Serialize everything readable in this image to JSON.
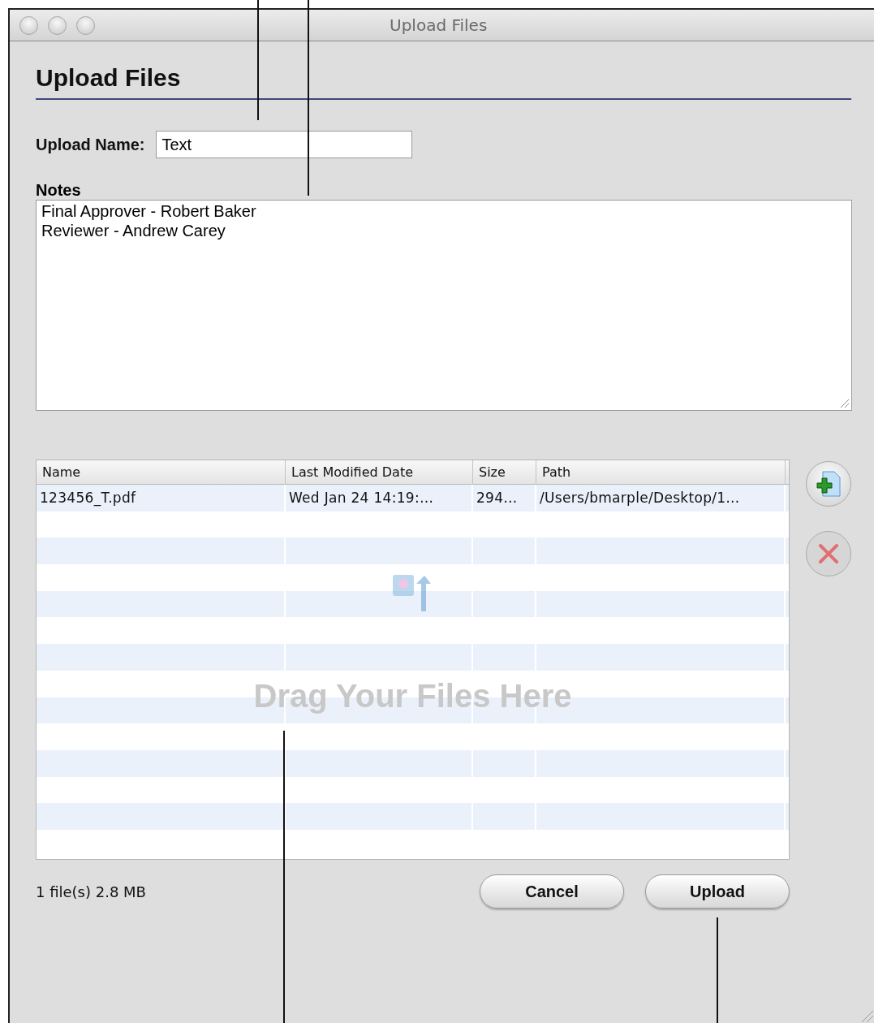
{
  "window": {
    "title": "Upload Files"
  },
  "heading": "Upload Files",
  "upload_name": {
    "label": "Upload Name:",
    "value": "Text"
  },
  "notes": {
    "label": "Notes",
    "lines": [
      "Final Approver - Robert Baker",
      "Reviewer - Andrew Carey"
    ]
  },
  "table": {
    "columns": [
      "Name",
      "Last Modified Date",
      "Size",
      "Path"
    ],
    "rows": [
      {
        "cells": [
          "123456_T.pdf",
          "Wed Jan 24 14:19:…",
          "294…",
          "/Users/bmarple/Desktop/1…"
        ]
      }
    ],
    "drop_message": "Drag Your Files Here"
  },
  "footer": {
    "summary": "1 file(s) 2.8 MB",
    "buttons": [
      "Cancel",
      "Upload"
    ]
  }
}
